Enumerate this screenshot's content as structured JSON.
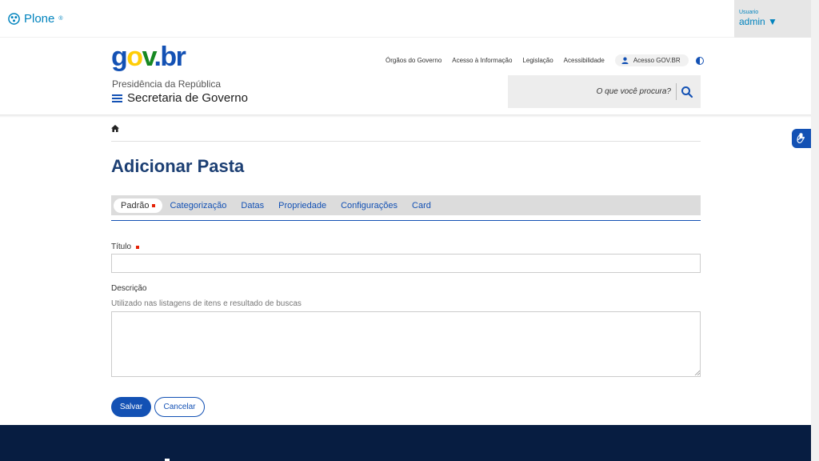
{
  "toolbar": {
    "brand": "Plone",
    "user_label": "Usuario",
    "user_name": "admin ▼"
  },
  "header": {
    "logo": {
      "g": "g",
      "o": "o",
      "v": "v",
      "dot": ".",
      "br": "br"
    },
    "org_sub": "Presidência da República",
    "org_main": "Secretaria de Governo",
    "links": [
      "Órgãos do Governo",
      "Acesso à Informação",
      "Legislação",
      "Acessibilidade"
    ],
    "gov_access": "Acesso GOV.BR",
    "search_placeholder": "O que você procura?"
  },
  "page": {
    "title": "Adicionar Pasta"
  },
  "tabs": [
    {
      "label": "Padrão",
      "active": true
    },
    {
      "label": "Categorização",
      "active": false
    },
    {
      "label": "Datas",
      "active": false
    },
    {
      "label": "Propriedade",
      "active": false
    },
    {
      "label": "Configurações",
      "active": false
    },
    {
      "label": "Card",
      "active": false
    }
  ],
  "form": {
    "title_label": "Título",
    "title_value": "",
    "desc_label": "Descrição",
    "desc_hint": "Utilizado nas listagens de itens e resultado de buscas",
    "desc_value": "",
    "save": "Salvar",
    "cancel": "Cancelar"
  },
  "colors": {
    "primary": "#1351b4",
    "footer": "#071d41",
    "required": "#e52207"
  }
}
